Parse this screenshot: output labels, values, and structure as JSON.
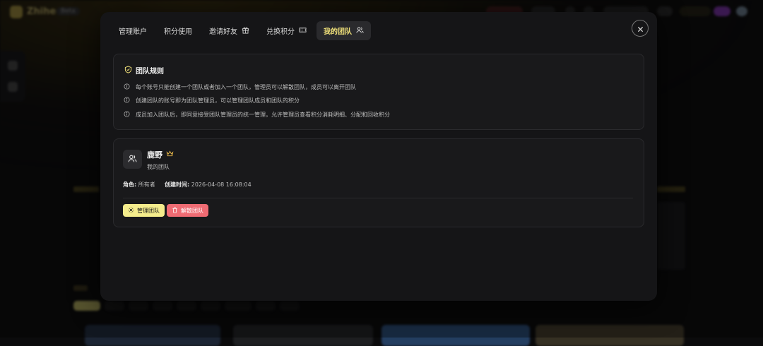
{
  "background": {
    "brand": "Zhihe",
    "tag": "Beta"
  },
  "modal": {
    "tabs": [
      {
        "label": "管理账户",
        "icon": null
      },
      {
        "label": "积分使用",
        "icon": null
      },
      {
        "label": "邀请好友",
        "icon": "gift-icon"
      },
      {
        "label": "兑换积分",
        "icon": "ticket-icon"
      },
      {
        "label": "我的团队",
        "icon": "users-icon",
        "active": true
      }
    ],
    "rules": {
      "title": "团队规则",
      "items": [
        "每个账号只能创建一个团队或者加入一个团队，管理员可以解散团队，成员可以离开团队",
        "创建团队的账号即为团队管理员，可以管理团队成员和团队的积分",
        "成员加入团队后，即同意接受团队管理员的统一管理，允许管理员查看积分消耗明细、分配和回收积分"
      ]
    },
    "team": {
      "name": "鹿野",
      "subtitle": "我的团队",
      "role_label": "角色:",
      "role_value": "所有者",
      "created_label": "创建时间:",
      "created_value": "2026-04-08 16:08:04",
      "manage_button": "管理团队",
      "dismiss_button": "解散团队"
    }
  },
  "colors": {
    "accent": "#f2e27a",
    "danger": "#ef6b73",
    "modal_bg": "#151517"
  }
}
